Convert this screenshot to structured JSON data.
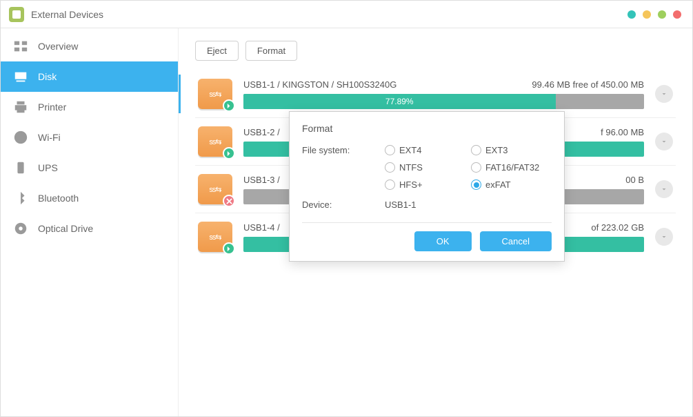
{
  "header": {
    "title": "External Devices"
  },
  "sidebar": {
    "items": [
      {
        "label": "Overview"
      },
      {
        "label": "Disk"
      },
      {
        "label": "Printer"
      },
      {
        "label": "Wi-Fi"
      },
      {
        "label": "UPS"
      },
      {
        "label": "Bluetooth"
      },
      {
        "label": "Optical Drive"
      }
    ]
  },
  "toolbar": {
    "eject_label": "Eject",
    "format_label": "Format"
  },
  "devices": [
    {
      "name": "USB1-1 / KINGSTON / SH100S3240G",
      "free": "99.46 MB free of 450.00 MB",
      "percent": "77.89%",
      "fill_pct": 77.89,
      "status": "ok"
    },
    {
      "name": "USB1-2 /",
      "free": "f 96.00 MB",
      "percent": "",
      "fill_pct": 100,
      "status": "ok"
    },
    {
      "name": "USB1-3 /",
      "free": "00 B",
      "percent": "",
      "fill_pct": 0,
      "status": "err"
    },
    {
      "name": "USB1-4 /",
      "free": "of 223.02 GB",
      "percent": "",
      "fill_pct": 100,
      "status": "ok"
    }
  ],
  "modal": {
    "title": "Format",
    "file_system_label": "File system:",
    "device_label": "Device:",
    "device_value": "USB1-1",
    "options": {
      "ext4": "EXT4",
      "ext3": "EXT3",
      "ntfs": "NTFS",
      "fat": "FAT16/FAT32",
      "hfs": "HFS+",
      "exfat": "exFAT"
    },
    "selected": "exfat",
    "ok_label": "OK",
    "cancel_label": "Cancel"
  }
}
